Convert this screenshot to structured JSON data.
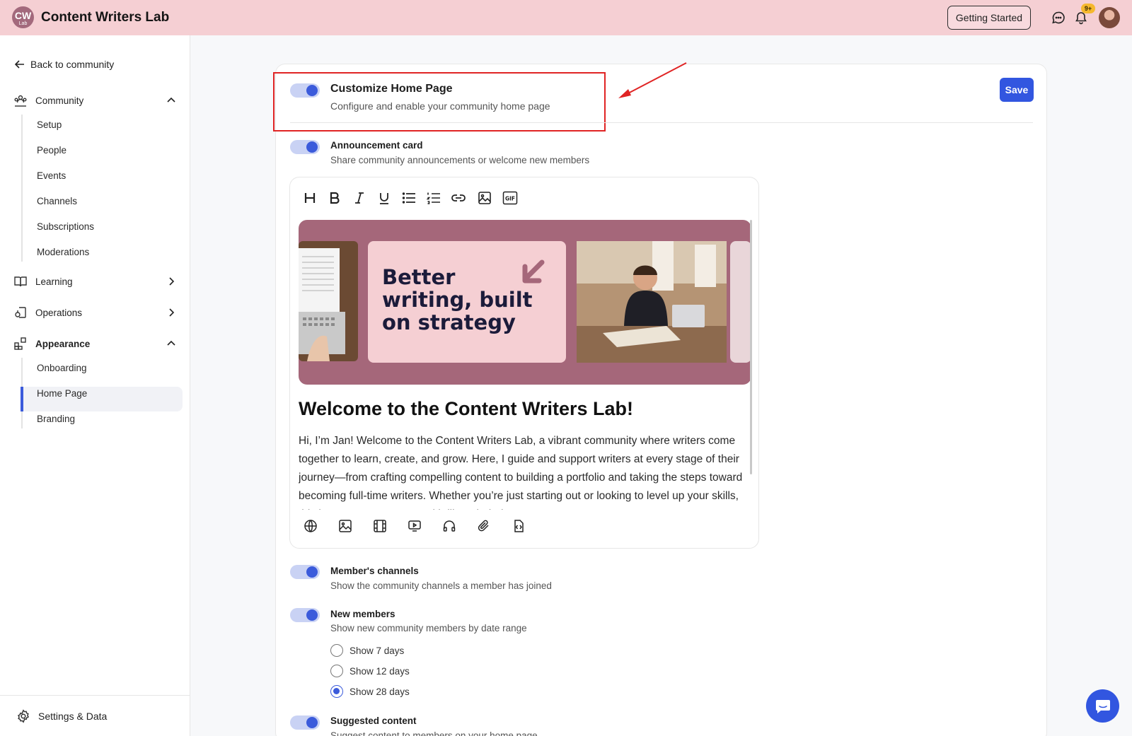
{
  "header": {
    "logo_text": "CW",
    "logo_sub": "Lab",
    "app_title": "Content Writers Lab",
    "getting_started": "Getting Started",
    "notification_badge": "9+"
  },
  "sidebar": {
    "back_label": "Back to community",
    "community": {
      "label": "Community",
      "items": [
        "Setup",
        "People",
        "Events",
        "Channels",
        "Subscriptions",
        "Moderations"
      ]
    },
    "learning_label": "Learning",
    "operations_label": "Operations",
    "appearance": {
      "label": "Appearance",
      "items": [
        "Onboarding",
        "Home Page",
        "Branding"
      ],
      "active": "Home Page"
    },
    "settings_label": "Settings & Data"
  },
  "main": {
    "title": "Customize Home Page",
    "description": "Configure and enable your community home page",
    "save_label": "Save",
    "announcement": {
      "title": "Announcement card",
      "description": "Share community announcements or welcome new members"
    },
    "editor": {
      "banner_text_line1": "Better",
      "banner_text_line2": "writing, built",
      "banner_text_line3": "on strategy",
      "heading": "Welcome to the Content Writers Lab!",
      "body": "Hi, I’m Jan! Welcome to the Content Writers Lab, a vibrant community where writers come together to learn, create, and grow. Here, I guide and support writers at every stage of their journey—from crafting compelling content to building a portfolio and taking the steps toward becoming full-time writers. Whether you’re just starting out or looking to level up your skills, this is a space to connect with like-minded creators, get"
    },
    "members_channels": {
      "title": "Member's channels",
      "description": "Show the community channels a member has joined"
    },
    "new_members": {
      "title": "New members",
      "description": "Show new community members by date range",
      "options": [
        "Show 7 days",
        "Show 12 days",
        "Show 28 days"
      ],
      "selected": "Show 28 days"
    },
    "suggested": {
      "title": "Suggested content",
      "description": "Suggest content to members on your home page"
    }
  },
  "colors": {
    "topbar": "#f5cfd3",
    "accent": "#3256e0",
    "banner": "#a5677a",
    "highlight": "#e02424"
  }
}
